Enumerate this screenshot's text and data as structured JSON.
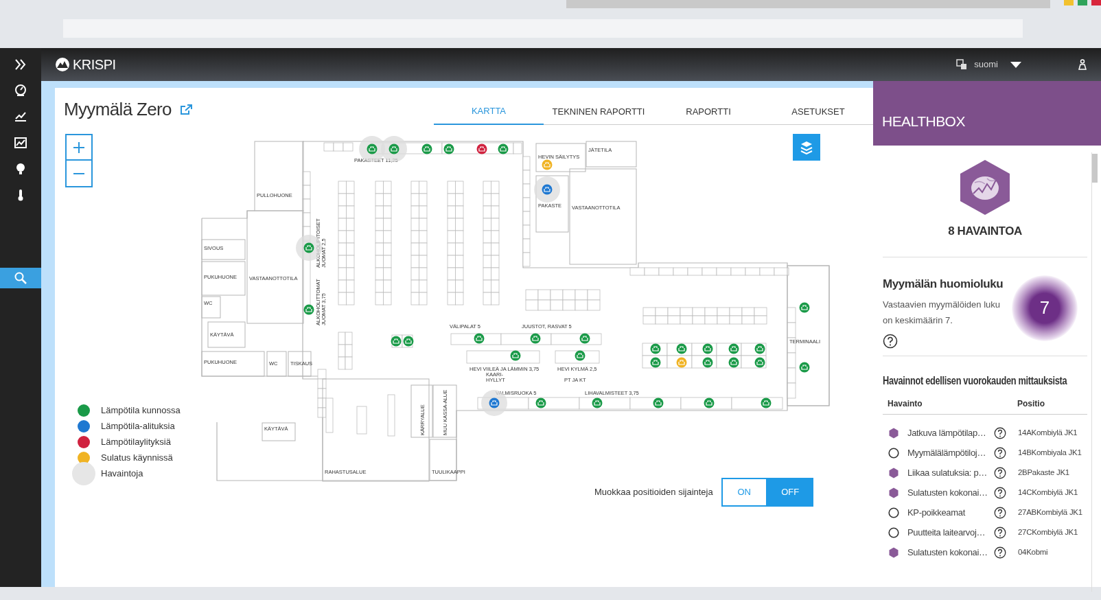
{
  "app": {
    "logo": "KRISPI",
    "language": "suomi"
  },
  "sidebar": {
    "items": [
      {
        "kind": "expand",
        "selected": false
      },
      {
        "kind": "gauge",
        "selected": false
      },
      {
        "kind": "chart",
        "selected": false
      },
      {
        "kind": "report",
        "selected": false
      },
      {
        "kind": "bulb",
        "selected": false
      },
      {
        "kind": "thermometer",
        "selected": false
      },
      {
        "kind": "search",
        "selected": true
      }
    ]
  },
  "store": {
    "title": "Myymälä Zero"
  },
  "tabs": [
    {
      "label": "KARTTA",
      "selected": true
    },
    {
      "label": "TEKNINEN RAPORTTI",
      "selected": false
    },
    {
      "label": "RAPORTTI",
      "selected": false
    },
    {
      "label": "ASETUKSET",
      "selected": false
    }
  ],
  "map": {
    "rooms": [
      "PULLOHUONE",
      "SIVOUS",
      "PUKUHUONE",
      "WC",
      "VASTAANOTTOTILA",
      "KÄYTÄVÄ",
      "PUKUHUONE",
      "WC",
      "TISKAUS",
      "KÄYTÄVÄ",
      "RAHASTUSALUE",
      "KÄRRYALUE",
      "MUU KASSA-ALUE",
      "TUULIKAAPPI",
      "HEVIN SÄILYTYS",
      "JÄTETILA",
      "PAKASTE",
      "VASTAANOTTOTILA",
      "TERMINAALI"
    ],
    "sections": [
      {
        "lines": [
          "PAKASTEET 11,25"
        ]
      },
      {
        "lines": [
          "ALKOHOLIPITOISET",
          "JUOMAT 2,5"
        ]
      },
      {
        "lines": [
          "ALKOHOLITTOMAT",
          "JUOMAT 3,75"
        ]
      },
      {
        "lines": [
          "VÄLIPALAT 5"
        ]
      },
      {
        "lines": [
          "JUUSTOT, RASVAT 5"
        ]
      },
      {
        "lines": [
          "HEVI VIILEÄ JA LÄMMIN 3,75",
          "KAARI-",
          "HYLLYT"
        ]
      },
      {
        "lines": [
          "HEVI KYLMÄ 2,5"
        ]
      },
      {
        "lines": [
          "PT JA KT"
        ]
      },
      {
        "lines": [
          "VALMISRUOKA 5"
        ]
      },
      {
        "lines": [
          "LIHAVALMISTEET 3,75"
        ]
      }
    ],
    "sensors": [
      {
        "kind": "ok",
        "observed": true
      },
      {
        "kind": "ok",
        "observed": true
      },
      {
        "kind": "ok",
        "observed": false
      },
      {
        "kind": "ok",
        "observed": false
      },
      {
        "kind": "high",
        "observed": false
      },
      {
        "kind": "ok",
        "observed": false
      },
      {
        "kind": "defrost",
        "observed": false
      },
      {
        "kind": "low",
        "observed": true
      },
      {
        "kind": "ok",
        "observed": true
      },
      {
        "kind": "ok",
        "observed": false
      },
      {
        "kind": "ok",
        "observed": false
      },
      {
        "kind": "ok",
        "observed": false
      },
      {
        "kind": "ok",
        "observed": false
      },
      {
        "kind": "ok",
        "observed": false
      },
      {
        "kind": "ok",
        "observed": false
      },
      {
        "kind": "ok",
        "observed": false
      },
      {
        "kind": "ok",
        "observed": false
      },
      {
        "kind": "ok",
        "observed": false
      },
      {
        "kind": "ok",
        "observed": false
      },
      {
        "kind": "ok",
        "observed": false
      },
      {
        "kind": "ok",
        "observed": false
      },
      {
        "kind": "ok",
        "observed": false
      },
      {
        "kind": "ok",
        "observed": false
      },
      {
        "kind": "defrost",
        "observed": false
      },
      {
        "kind": "ok",
        "observed": false
      },
      {
        "kind": "ok",
        "observed": false
      },
      {
        "kind": "ok",
        "observed": false
      },
      {
        "kind": "ok",
        "observed": false
      },
      {
        "kind": "ok",
        "observed": false
      },
      {
        "kind": "low",
        "observed": true
      },
      {
        "kind": "ok",
        "observed": false
      },
      {
        "kind": "ok",
        "observed": false
      },
      {
        "kind": "ok",
        "observed": false
      },
      {
        "kind": "ok",
        "observed": false
      },
      {
        "kind": "ok",
        "observed": false
      }
    ]
  },
  "legend": [
    {
      "kind": "ok",
      "label": "Lämpötila kunnossa",
      "color": "#1a9a48"
    },
    {
      "kind": "low",
      "label": "Lämpötila-alituksia",
      "color": "#1f78d1"
    },
    {
      "kind": "high",
      "label": "Lämpötilaylityksiä",
      "color": "#d0223f"
    },
    {
      "kind": "defrost",
      "label": "Sulatus käynnissä",
      "color": "#f0b323"
    },
    {
      "kind": "observation",
      "label": "Havaintoja",
      "color": "#e6e6e6"
    }
  ],
  "position_edit": {
    "label": "Muokkaa positioiden sijainteja",
    "options": [
      {
        "label": "ON",
        "selected": false
      },
      {
        "label": "OFF",
        "selected": true
      }
    ]
  },
  "healthbox": {
    "title": "HEALTHBOX",
    "count": "8 HAVAINTOA",
    "score": {
      "title": "Myymälän huomioluku",
      "description": "Vastaavien myymälöiden luku on keskimäärin 7.",
      "value": "7"
    },
    "observations": {
      "title": "Havainnot edellisen vuorokauden mittauksista",
      "columns": [
        "Havainto",
        "Positio"
      ],
      "rows": [
        {
          "flagged": true,
          "text": "Jatkuva lämpötilap…",
          "position": "14AKombiylä JK1"
        },
        {
          "flagged": false,
          "text": "Myymälälämpötiloj…",
          "position": "14BKombiyala JK1"
        },
        {
          "flagged": true,
          "text": "Liikaa sulatuksia: p…",
          "position": "2BPakaste JK1"
        },
        {
          "flagged": true,
          "text": "Sulatusten kokonai…",
          "position": "14CKombiylä JK1"
        },
        {
          "flagged": false,
          "text": "KP-poikkeamat",
          "position": "27ABKombiylä JK1"
        },
        {
          "flagged": false,
          "text": "Puutteita laitearvoj…",
          "position": "27CKombiylä JK1"
        },
        {
          "flagged": true,
          "text": "Sulatusten kokonai…",
          "position": "04Kobmi"
        }
      ]
    }
  }
}
